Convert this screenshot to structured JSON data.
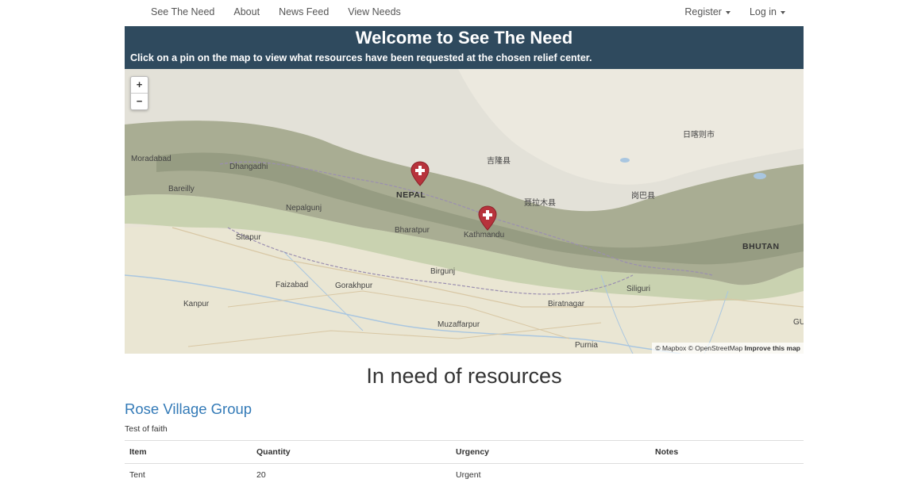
{
  "nav": {
    "left": [
      "See The Need",
      "About",
      "News Feed",
      "View Needs"
    ],
    "register": "Register",
    "login": "Log in"
  },
  "banner": {
    "title": "Welcome to See The Need",
    "subtitle": "Click on a pin on the map to view what resources have been requested at the chosen relief center."
  },
  "map": {
    "zoom_in": "+",
    "zoom_out": "−",
    "labels": {
      "moradabad": "Moradabad",
      "dhangadhi": "Dhangadhi",
      "bareilly": "Bareilly",
      "nepalgunj": "Nepalgunj",
      "sitapur": "Sitapur",
      "faizabad": "Faizabad",
      "gorakhpur": "Gorakhpur",
      "kanpur": "Kanpur",
      "bharatpur": "Bharatpur",
      "kathmandu": "Kathmandu",
      "birgunj": "Birgunj",
      "muzaffarpur": "Muzaffarpur",
      "biratnagar": "Biratnagar",
      "purnia": "Purnia",
      "siliguri": "Siliguri",
      "nepal": "NEPAL",
      "bhutan": "BHUTAN",
      "gyirong": "吉隆县",
      "nyalam": "聂拉木县",
      "kangmar": "岗巴县",
      "shigatse": "日喀则市",
      "gu": "GU"
    },
    "attribution_sources": "© Mapbox © OpenStreetMap",
    "attribution_improve": "Improve this map"
  },
  "section_title": "In need of resources",
  "group": {
    "name": "Rose Village Group",
    "description": "Test of faith",
    "columns": [
      "Item",
      "Quantity",
      "Urgency",
      "Notes"
    ],
    "rows": [
      {
        "item": "Tent",
        "quantity": "20",
        "urgency": "Urgent",
        "notes": ""
      }
    ]
  },
  "colors": {
    "banner_bg": "#2f4a5e",
    "link": "#337ab7",
    "pin": "#b7333c"
  }
}
